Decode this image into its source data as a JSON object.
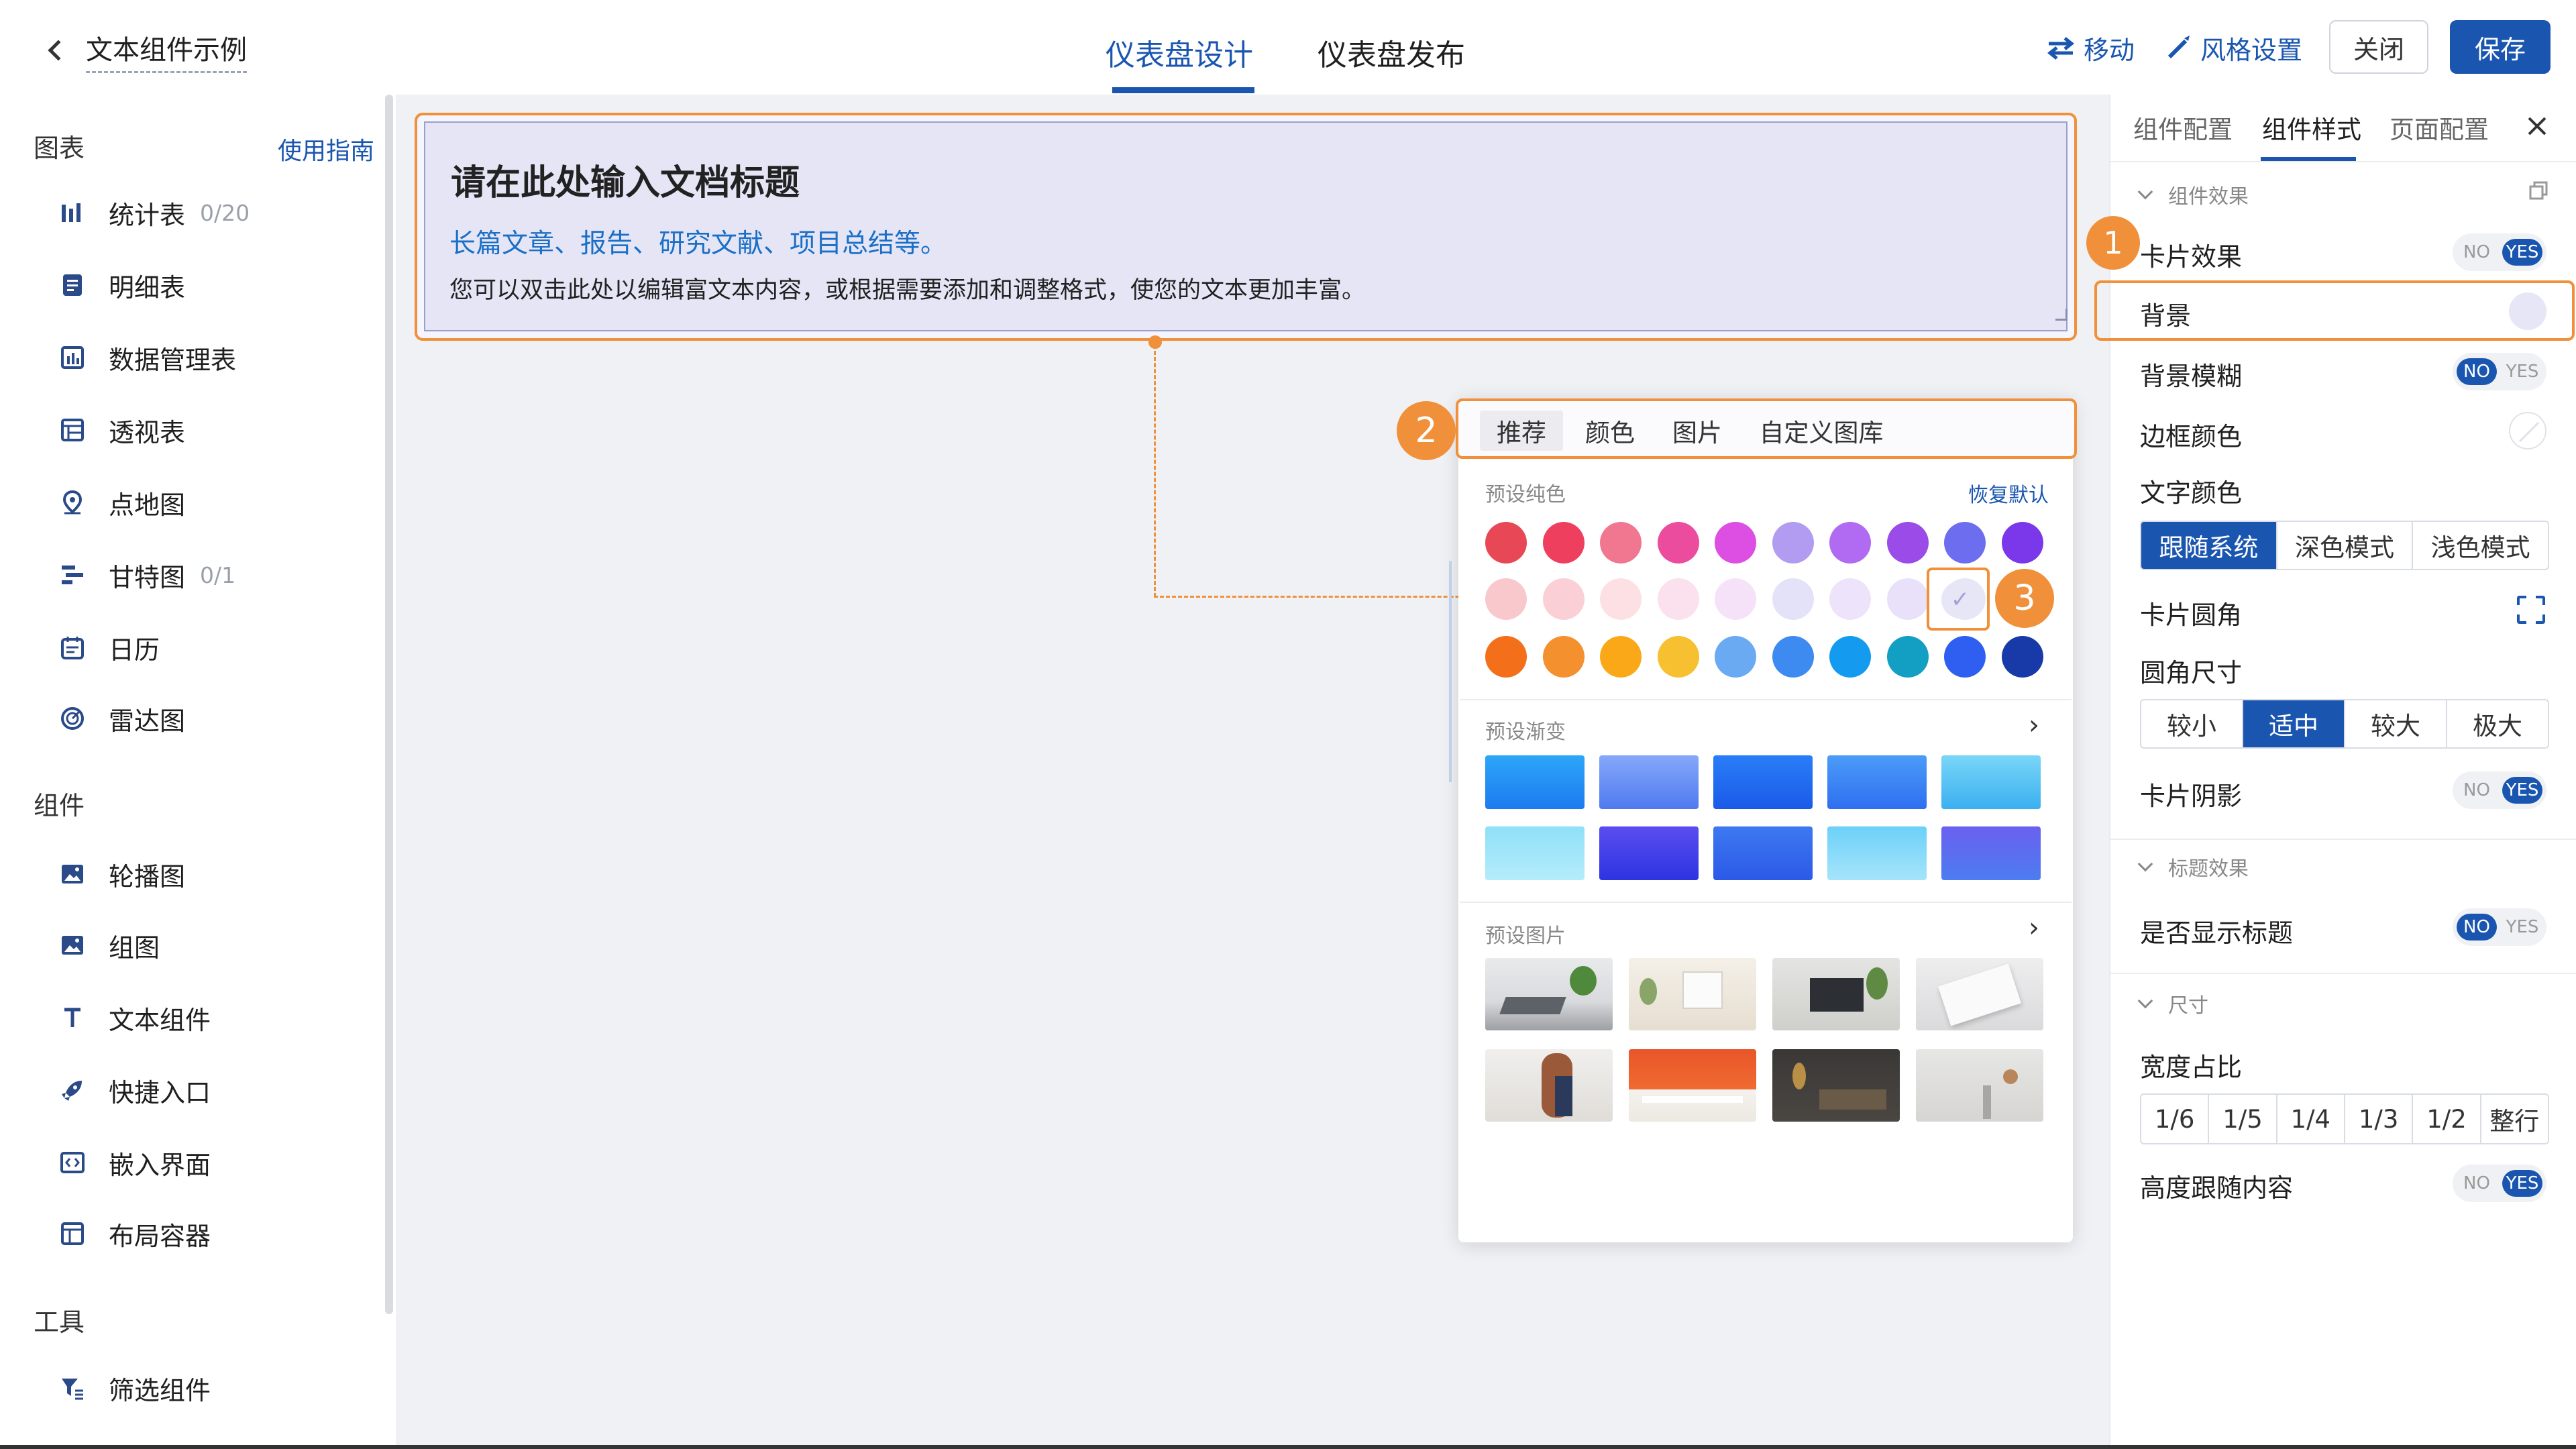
{
  "header": {
    "back_title": "文本组件示例",
    "tabs": [
      "仪表盘设计",
      "仪表盘发布"
    ],
    "actions": {
      "move": "移动",
      "style": "风格设置"
    },
    "close_label": "关闭",
    "save_label": "保存"
  },
  "sidebar": {
    "charts_title": "图表",
    "guide_link": "使用指南",
    "charts": [
      {
        "label": "统计表",
        "count": "0/20",
        "icon": "bar-chart-icon"
      },
      {
        "label": "明细表",
        "count": "",
        "icon": "detail-table-icon"
      },
      {
        "label": "数据管理表",
        "count": "",
        "icon": "data-table-icon"
      },
      {
        "label": "透视表",
        "count": "",
        "icon": "pivot-table-icon"
      },
      {
        "label": "点地图",
        "count": "",
        "icon": "map-pin-icon"
      },
      {
        "label": "甘特图",
        "count": "0/1",
        "icon": "gantt-icon"
      },
      {
        "label": "日历",
        "count": "",
        "icon": "calendar-icon"
      },
      {
        "label": "雷达图",
        "count": "",
        "icon": "radar-icon"
      }
    ],
    "components_title": "组件",
    "components": [
      {
        "label": "轮播图",
        "icon": "carousel-icon"
      },
      {
        "label": "组图",
        "icon": "image-group-icon"
      },
      {
        "label": "文本组件",
        "icon": "text-icon"
      },
      {
        "label": "快捷入口",
        "icon": "rocket-icon"
      },
      {
        "label": "嵌入界面",
        "icon": "embed-icon"
      },
      {
        "label": "布局容器",
        "icon": "layout-icon"
      }
    ],
    "tools_title": "工具",
    "tools": [
      {
        "label": "筛选组件",
        "icon": "filter-icon"
      }
    ]
  },
  "canvas": {
    "title": "请在此处输入文档标题",
    "subtitle": "长篇文章、报告、研究文献、项目总结等。",
    "description": "您可以双击此处以编辑富文本内容，或根据需要添加和调整格式，使您的文本更加丰富。"
  },
  "popup": {
    "tabs": [
      "推荐",
      "颜色",
      "图片",
      "自定义图库"
    ],
    "selected_tab": "推荐",
    "solid_label": "预设纯色",
    "restore_label": "恢复默认",
    "solid_colors": [
      [
        "#e84855",
        "#ef3f5e",
        "#f17690",
        "#ec4c9d",
        "#dd4ee3",
        "#b19cf2",
        "#b06bf2",
        "#9a4be8",
        "#6d6df0",
        "#7b38eb"
      ],
      [
        "#f8c8cc",
        "#fad0d6",
        "#fde0e4",
        "#fbe0ee",
        "#f6e2f8",
        "#e4e2f8",
        "#ede3fb",
        "#e9e0fa",
        "#e6e6f6",
        ""
      ],
      [
        "#f36f1a",
        "#f4902e",
        "#fba818",
        "#f6c030",
        "#6aaaf2",
        "#3d8bf0",
        "#149bf0",
        "#139ec3",
        "#2f5ff0",
        "#173aa8"
      ]
    ],
    "selected_swatch_check": "✓",
    "gradient_label": "预设渐变",
    "gradients": [
      [
        "#2da6f8",
        "#1c7bf0"
      ],
      [
        "#86a8fa",
        "#4f7af0"
      ],
      [
        "#2a7ef8",
        "#1a5ae8"
      ],
      [
        "#4b9cf8",
        "#2f6ff0"
      ],
      [
        "#7ad6f8",
        "#3bb0f0"
      ],
      [
        "#8fe0f8",
        "#b4ecfb"
      ],
      [
        "#5a4df0",
        "#2d34e0"
      ],
      [
        "#3d78f0",
        "#2c5ae8"
      ],
      [
        "#6cd0f8",
        "#a6e4fb"
      ],
      [
        "#6a60f0",
        "#4d7cf0"
      ]
    ],
    "image_label": "预设图片",
    "markers": [
      "2",
      "3"
    ]
  },
  "right_panel": {
    "tabs": [
      "组件配置",
      "组件样式",
      "页面配置"
    ],
    "selected_tab": "组件样式",
    "marker": "1",
    "sections": {
      "effect": "组件效果",
      "title_effect": "标题效果",
      "size": "尺寸"
    },
    "rows": {
      "card_effect": "卡片效果",
      "background": "背景",
      "background_blur": "背景模糊",
      "border_color": "边框颜色",
      "text_color": "文字颜色",
      "card_radius": "卡片圆角",
      "radius_size": "圆角尺寸",
      "card_shadow": "卡片阴影",
      "show_title": "是否显示标题",
      "width_ratio": "宽度占比",
      "height_follow": "高度跟随内容"
    },
    "toggle_no": "NO",
    "toggle_yes": "YES",
    "toggles": {
      "card_effect": "YES",
      "background_blur": "NO",
      "card_shadow": "YES",
      "show_title": "NO",
      "height_follow": "YES"
    },
    "text_color_options": [
      "跟随系统",
      "深色模式",
      "浅色模式"
    ],
    "text_color_selected": "跟随系统",
    "radius_options": [
      "较小",
      "适中",
      "较大",
      "极大"
    ],
    "radius_selected": "适中",
    "width_options": [
      "1/6",
      "1/5",
      "1/4",
      "1/3",
      "1/2",
      "整行"
    ],
    "background_swatch": "#e6e6f6"
  }
}
